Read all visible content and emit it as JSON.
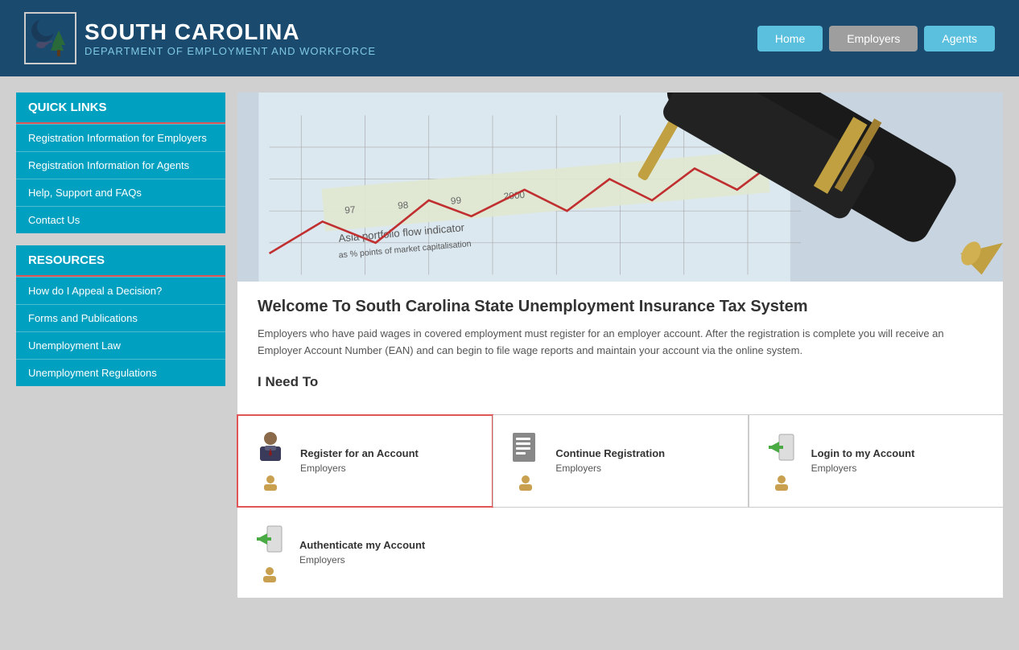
{
  "header": {
    "logo_dew": "dew",
    "logo_title": "SOUTH CAROLINA",
    "logo_subtitle": "DEPARTMENT OF EMPLOYMENT AND WORKFORCE",
    "nav": {
      "home": "Home",
      "employers": "Employers",
      "agents": "Agents"
    }
  },
  "sidebar": {
    "quick_links_header": "QUICK LINKS",
    "quick_links": [
      {
        "label": "Registration Information for Employers"
      },
      {
        "label": "Registration Information for Agents"
      },
      {
        "label": "Help, Support and FAQs"
      },
      {
        "label": "Contact Us"
      }
    ],
    "resources_header": "RESOURCES",
    "resources": [
      {
        "label": "How do I Appeal a Decision?"
      },
      {
        "label": "Forms and Publications"
      },
      {
        "label": "Unemployment Law"
      },
      {
        "label": "Unemployment Regulations"
      }
    ]
  },
  "main": {
    "welcome_title": "Welcome To South Carolina State Unemployment Insurance Tax System",
    "welcome_text": "Employers who have paid wages in covered employment must register for an employer account. After the registration is complete you will receive an Employer Account Number (EAN) and can begin to file wage reports and maintain your account via the online system.",
    "i_need_to": "I Need To",
    "cards": [
      {
        "title": "Register for an Account",
        "sub": "Employers",
        "highlighted": true
      },
      {
        "title": "Continue Registration",
        "sub": "Employers",
        "highlighted": false
      },
      {
        "title": "Login to my Account",
        "sub": "Employers",
        "highlighted": false
      }
    ],
    "card_row2": {
      "title": "Authenticate my Account",
      "sub": "Employers"
    }
  }
}
